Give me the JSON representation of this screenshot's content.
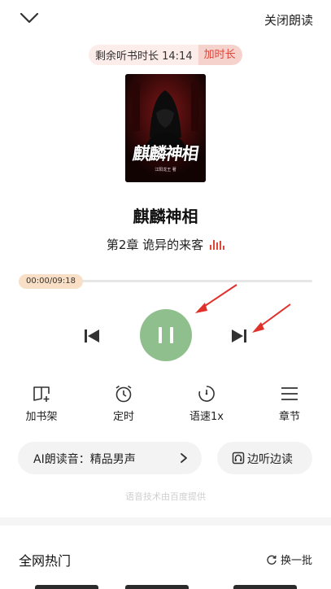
{
  "header": {
    "back_icon": "chevron-down-icon",
    "close_label": "关闭朗读"
  },
  "timer": {
    "remaining_label": "剩余听书时长 14:14",
    "extend_label": "加时长"
  },
  "book": {
    "cover_title": "麒麟神相",
    "cover_author": "江阳龙王 著",
    "title": "麒麟神相",
    "chapter": "第2章 诡异的来客"
  },
  "player": {
    "time_label": "00:00/09:18",
    "progress": 0.0,
    "state": "playing",
    "accent_color": "#8fbf8d",
    "annotation_color": "#e0312b"
  },
  "functions": [
    {
      "icon": "add-bookshelf-icon",
      "label": "加书架"
    },
    {
      "icon": "alarm-clock-icon",
      "label": "定时"
    },
    {
      "icon": "speedometer-icon",
      "label": "语速1x"
    },
    {
      "icon": "menu-list-icon",
      "label": "章节"
    }
  ],
  "voice": {
    "label": "AI朗读音：精品男声",
    "listen_read_label": "边听边读"
  },
  "credit": "语音技术由百度提供",
  "hot": {
    "title": "全网热门",
    "refresh_label": "换一批"
  }
}
